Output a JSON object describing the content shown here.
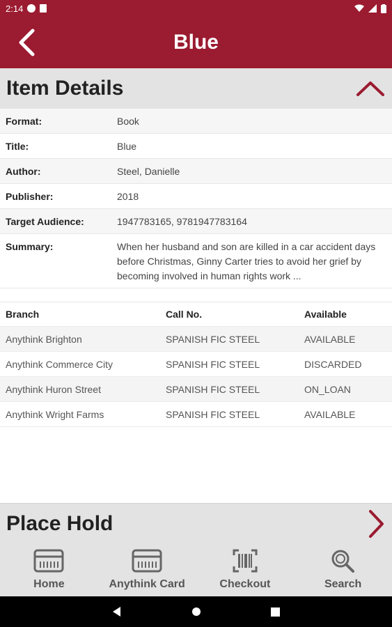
{
  "status": {
    "time": "2:14"
  },
  "appbar": {
    "title": "Blue"
  },
  "item_details": {
    "heading": "Item Details",
    "rows": [
      {
        "label": "Format:",
        "value": "Book"
      },
      {
        "label": "Title:",
        "value": "Blue"
      },
      {
        "label": "Author:",
        "value": "Steel, Danielle"
      },
      {
        "label": "Publisher:",
        "value": "2018"
      },
      {
        "label": "Target Audience:",
        "value": "1947783165, 9781947783164"
      },
      {
        "label": "Summary:",
        "value": "When her husband and son are killed in a car accident days before Christmas, Ginny Carter tries to avoid her grief by becoming involved in human rights work ..."
      }
    ]
  },
  "holdings": {
    "headers": {
      "branch": "Branch",
      "call_no": "Call No.",
      "available": "Available"
    },
    "rows": [
      {
        "branch": "Anythink Brighton",
        "call_no": "SPANISH FIC STEEL",
        "available": "AVAILABLE"
      },
      {
        "branch": "Anythink Commerce City",
        "call_no": "SPANISH FIC STEEL",
        "available": "DISCARDED"
      },
      {
        "branch": "Anythink Huron Street",
        "call_no": "SPANISH FIC STEEL",
        "available": "ON_LOAN"
      },
      {
        "branch": "Anythink Wright Farms",
        "call_no": "SPANISH FIC STEEL",
        "available": "AVAILABLE"
      }
    ]
  },
  "place_hold": {
    "heading": "Place Hold"
  },
  "bottom_nav": [
    {
      "label": "Home",
      "icon": "card-icon"
    },
    {
      "label": "Anythink Card",
      "icon": "card-icon"
    },
    {
      "label": "Checkout",
      "icon": "barcode-scan-icon"
    },
    {
      "label": "Search",
      "icon": "search-icon"
    }
  ],
  "colors": {
    "brand": "#9b1b30",
    "section_bg": "#e3e3e3",
    "nav_icon": "#666666"
  }
}
